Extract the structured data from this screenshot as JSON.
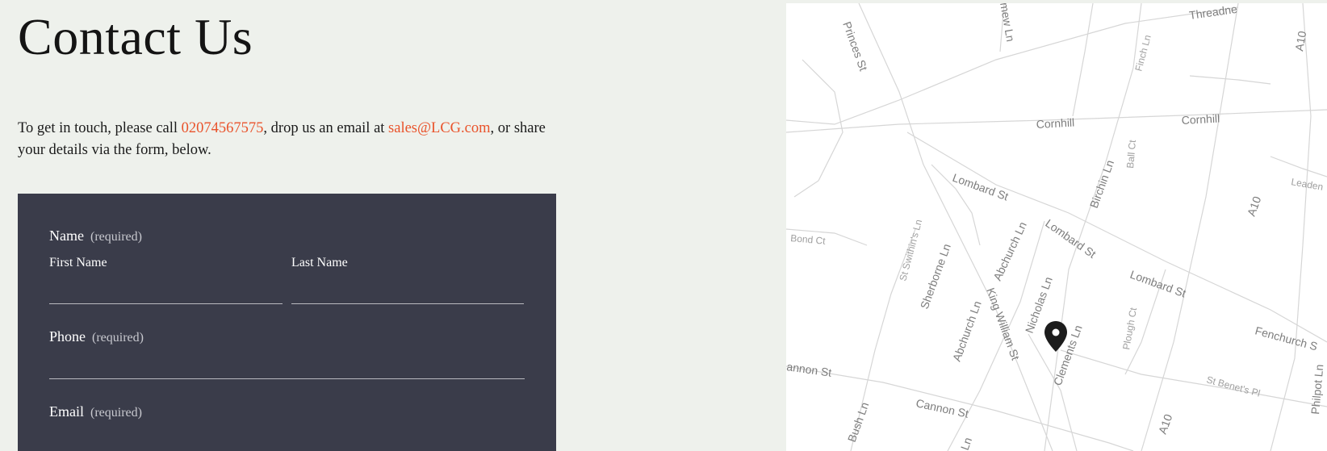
{
  "page": {
    "title": "Contact Us"
  },
  "intro": {
    "text_before_phone": "To get in touch, please call ",
    "phone": "02074567575",
    "text_after_phone": ", drop us an email at ",
    "email": "sales@LCG.com",
    "text_after_email": ", or share your details via the form, below."
  },
  "form": {
    "name": {
      "label": "Name",
      "required": "(required)",
      "first_label": "First Name",
      "last_label": "Last Name",
      "first_value": "",
      "last_value": ""
    },
    "phone": {
      "label": "Phone",
      "required": "(required)",
      "value": ""
    },
    "email": {
      "label": "Email",
      "required": "(required)"
    }
  },
  "map": {
    "streets": [
      "Princes St",
      "mew Ln",
      "Threadne",
      "Finch Ln",
      "A10",
      "Cornhill",
      "Cornhill",
      "Ball Ct",
      "Leaden",
      "Lombard St",
      "Birchin Ln",
      "Bond Ct",
      "Abchurch Ln",
      "Lombard St",
      "A10",
      "St Swithin's Ln",
      "Lombard St",
      "Sherborne Ln",
      "Nicholas Ln",
      "King William St",
      "Plough Ct",
      "Abchurch Ln",
      "Clements Ln",
      "Fenchurch S",
      "annon St",
      "St Benet's Pl",
      "Philpot Ln",
      "Cannon St",
      "Bush Ln",
      "A10",
      "Ln"
    ],
    "marker_icon": "map-pin-icon"
  }
}
